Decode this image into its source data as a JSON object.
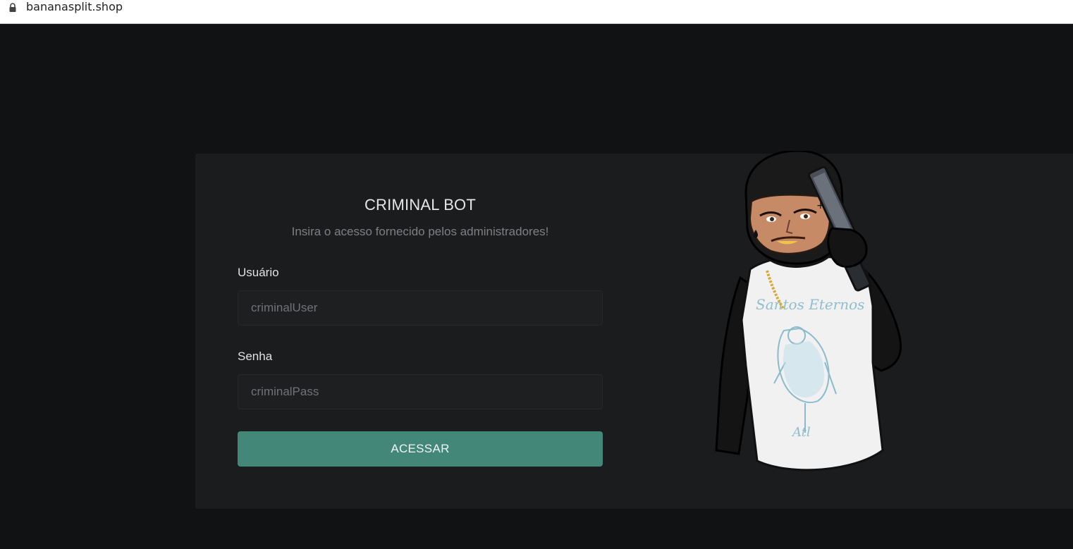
{
  "browser": {
    "url": "bananasplit.shop"
  },
  "login": {
    "title": "CRIMINAL BOT",
    "subtitle": "Insira o acesso fornecido pelos administradores!",
    "username_label": "Usuário",
    "username_placeholder": "criminalUser",
    "password_label": "Senha",
    "password_placeholder": "criminalPass",
    "submit_label": "ACESSAR"
  },
  "illustration": {
    "shirt_text": "Santos Eternos",
    "shirt_small_text": "Atl"
  },
  "colors": {
    "page_bg": "#111214",
    "card_bg": "#1b1c1e",
    "button_bg": "#428777"
  }
}
